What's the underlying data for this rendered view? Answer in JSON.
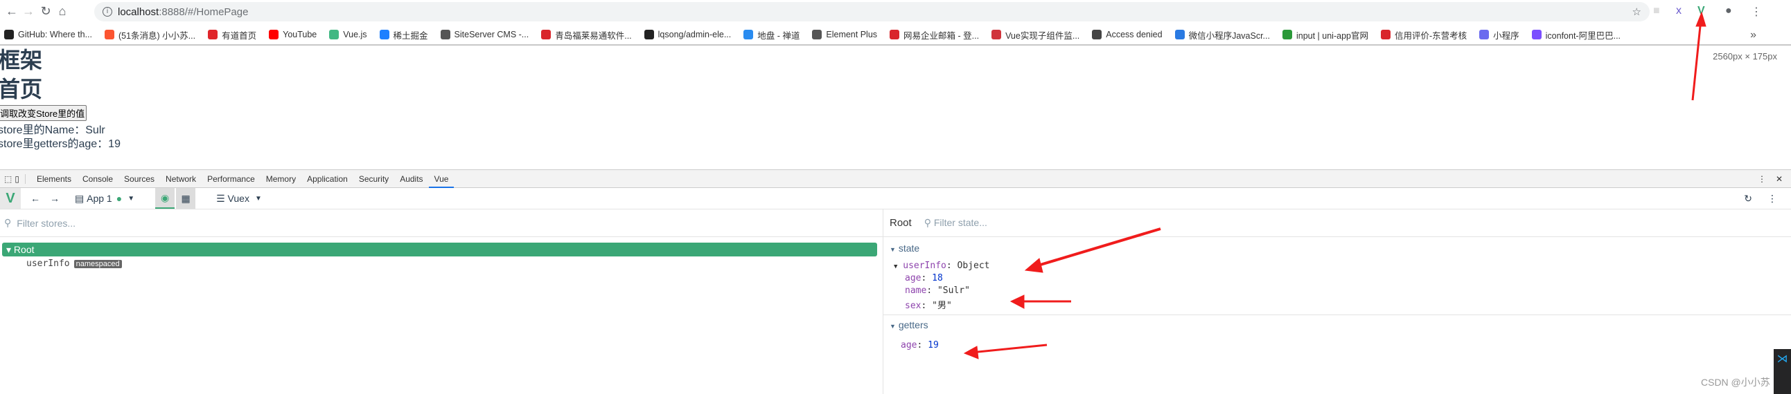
{
  "browser": {
    "url_host": "localhost",
    "url_path": ":8888/#/HomePage",
    "bookmarks": [
      {
        "label": "GitHub: Where th...",
        "color": "#222"
      },
      {
        "label": "(51条消息) 小小苏...",
        "color": "#fc5531"
      },
      {
        "label": "有道首页",
        "color": "#e0262b"
      },
      {
        "label": "YouTube",
        "color": "#ff0000"
      },
      {
        "label": "Vue.js",
        "color": "#41b883"
      },
      {
        "label": "稀土掘金",
        "color": "#1e80ff"
      },
      {
        "label": "SiteServer CMS -...",
        "color": "#555"
      },
      {
        "label": "青岛福莱易通软件...",
        "color": "#d9252b"
      },
      {
        "label": "lqsong/admin-ele...",
        "color": "#222"
      },
      {
        "label": "地盘 - 禅道",
        "color": "#2a8cf0"
      },
      {
        "label": "Element Plus",
        "color": "#555"
      },
      {
        "label": "网易企业邮箱 - 登...",
        "color": "#d9252b"
      },
      {
        "label": "Vue实现子组件监...",
        "color": "#d0343c"
      },
      {
        "label": "Access denied",
        "color": "#444"
      },
      {
        "label": "微信小程序JavaScr...",
        "color": "#2a7ae2"
      },
      {
        "label": "input | uni-app官网",
        "color": "#2b9939"
      },
      {
        "label": "信用评价-东营考核",
        "color": "#d9252b"
      },
      {
        "label": "小程序",
        "color": "#6b6bef"
      },
      {
        "label": "iconfont-阿里巴巴...",
        "color": "#7b4fff"
      }
    ],
    "more": "»"
  },
  "page": {
    "title1": "框架",
    "title2": "首页",
    "button": "调取改变Store里的值",
    "line1": "store里的Name：Sulr",
    "line2": "store里getters的age：19",
    "dims": "2560px × 175px"
  },
  "devtools": {
    "tabs": [
      "Elements",
      "Console",
      "Sources",
      "Network",
      "Performance",
      "Memory",
      "Application",
      "Security",
      "Audits",
      "Vue"
    ],
    "active_tab": "Vue",
    "toolbar": {
      "app": "App 1",
      "vuex": "Vuex"
    },
    "filter_stores_placeholder": "Filter stores...",
    "root": "Root",
    "module": "userInfo",
    "badge": "namespaced",
    "right": {
      "root": "Root",
      "filter_state_placeholder": "Filter state...",
      "state": "state",
      "userinfo_key": "userInfo",
      "userinfo_val": "Object",
      "fields": [
        {
          "key": "age",
          "value": "18",
          "type": "number"
        },
        {
          "key": "name",
          "value": "\"Sulr\"",
          "type": "string"
        },
        {
          "key": "sex",
          "value": "\"男\"",
          "type": "string"
        }
      ],
      "getters": "getters",
      "getter_key": "age",
      "getter_val": "19"
    }
  },
  "watermark": "CSDN @小小苏",
  "colors": {
    "vue_green": "#3ba776",
    "annotation_arrow": "#f01c1c"
  }
}
